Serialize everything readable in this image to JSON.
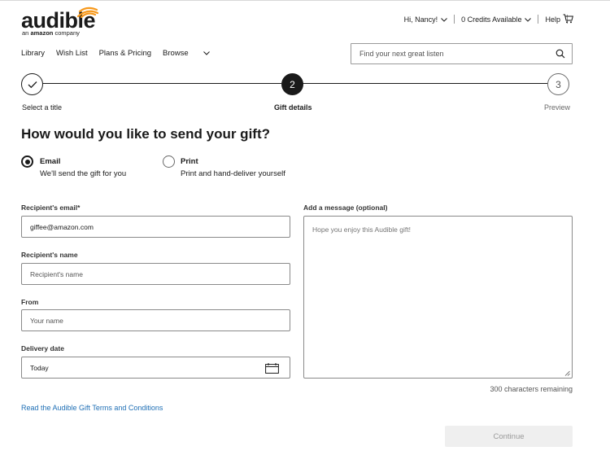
{
  "brand": {
    "name": "audible",
    "sub_prefix": "an",
    "sub_brand": "amazon",
    "sub_suffix": "company",
    "accent": "#f7991c"
  },
  "topnav": {
    "greeting": "Hi, Nancy!",
    "credits": "0 Credits Available",
    "help": "Help",
    "cart_icon": "cart-icon"
  },
  "mainnav": {
    "items": [
      "Library",
      "Wish List",
      "Plans & Pricing",
      "Browse"
    ]
  },
  "search": {
    "placeholder": "Find your next great listen"
  },
  "stepper": {
    "steps": [
      {
        "label": "Select a title",
        "number": "",
        "state": "complete"
      },
      {
        "label": "Gift details",
        "number": "2",
        "state": "current"
      },
      {
        "label": "Preview",
        "number": "3",
        "state": "upcoming"
      }
    ]
  },
  "heading": "How would you like to send your gift?",
  "delivery": {
    "email": {
      "title": "Email",
      "desc": "We'll send the gift for you",
      "selected": true
    },
    "print": {
      "title": "Print",
      "desc": "Print and hand-deliver yourself",
      "selected": false
    }
  },
  "form": {
    "recipient_email": {
      "label": "Recipient's email*",
      "value": "giffee@amazon.com"
    },
    "recipient_name": {
      "label": "Recipient's name",
      "placeholder": "Recipient's name"
    },
    "from": {
      "label": "From",
      "placeholder": "Your name"
    },
    "delivery_date": {
      "label": "Delivery date",
      "value": "Today"
    },
    "message": {
      "label": "Add a message (optional)",
      "placeholder": "Hope you enjoy this Audible gift!"
    },
    "remaining": "300 characters remaining"
  },
  "terms_link": "Read the Audible Gift Terms and Conditions",
  "continue_label": "Continue"
}
